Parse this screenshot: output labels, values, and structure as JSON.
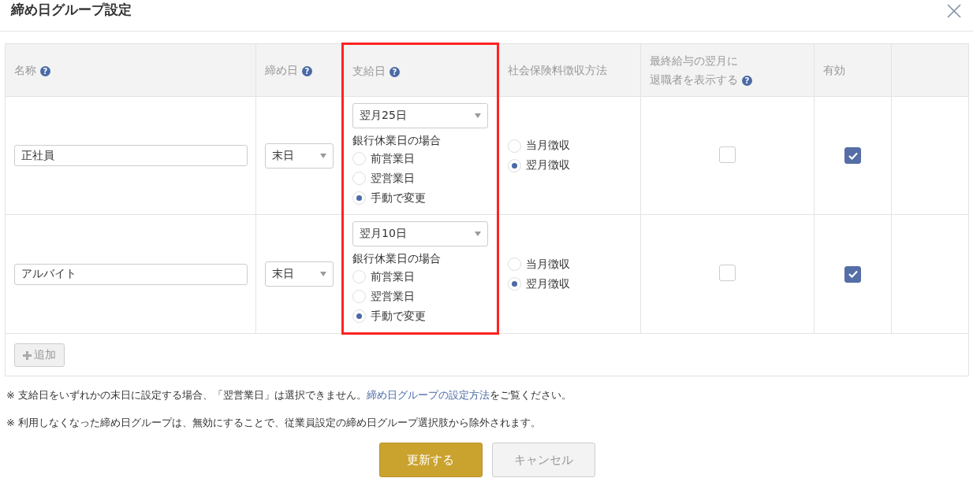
{
  "dialog": {
    "title": "締め日グループ設定"
  },
  "table": {
    "columns": [
      {
        "label_lines": [
          "名称"
        ],
        "help": "?",
        "highlighted": false
      },
      {
        "label_lines": [
          "締め日"
        ],
        "help": "?",
        "highlighted": false
      },
      {
        "label_lines": [
          "支給日"
        ],
        "help": "?",
        "highlighted": true
      },
      {
        "label_lines": [
          "社会保険料徴収方法"
        ],
        "highlighted": false
      },
      {
        "label_lines": [
          "最終給与の翌月に",
          "退職者を表示する"
        ],
        "help": "?",
        "highlighted": false
      },
      {
        "label_lines": [
          "有効"
        ],
        "highlighted": false
      }
    ],
    "rows": [
      {
        "name": "正社員",
        "closing_day": "末日",
        "pay_day": "翌月25日",
        "holiday_label": "銀行休業日の場合",
        "holiday_options": [
          {
            "label": "前営業日",
            "selected": false
          },
          {
            "label": "翌営業日",
            "selected": false
          },
          {
            "label": "手動で変更",
            "selected": true
          }
        ],
        "insurance_options": [
          {
            "label": "当月徴収",
            "selected": false
          },
          {
            "label": "翌月徴収",
            "selected": true
          }
        ],
        "show_retired": false,
        "enabled": true
      },
      {
        "name": "アルバイト",
        "closing_day": "末日",
        "pay_day": "翌月10日",
        "holiday_label": "銀行休業日の場合",
        "holiday_options": [
          {
            "label": "前営業日",
            "selected": false
          },
          {
            "label": "翌営業日",
            "selected": false
          },
          {
            "label": "手動で変更",
            "selected": true
          }
        ],
        "insurance_options": [
          {
            "label": "当月徴収",
            "selected": false
          },
          {
            "label": "翌月徴収",
            "selected": true
          }
        ],
        "show_retired": false,
        "enabled": true
      }
    ],
    "add_button": "追加"
  },
  "notes": [
    {
      "text": "※ 支給日をいずれかの末日に設定する場合、「翌営業日」は選択できません。",
      "link": "締め日グループの設定方法",
      "after": "をご覧ください。"
    },
    {
      "text": "※ 利用しなくなった締め日グループは、無効にすることで、従業員設定の締め日グループ選択肢から除外されます。"
    }
  ],
  "buttons": [
    {
      "label": "更新する",
      "kind": "primary"
    },
    {
      "label": "キャンセル",
      "kind": "secondary"
    }
  ]
}
